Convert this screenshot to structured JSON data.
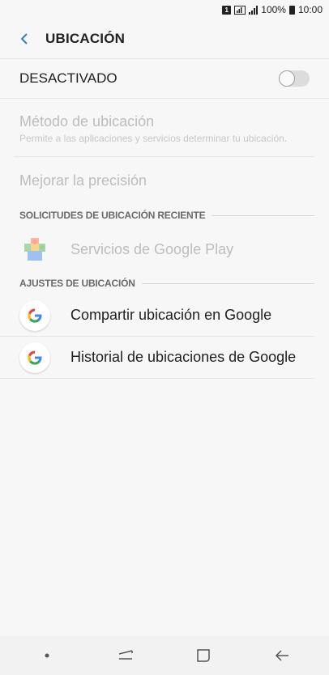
{
  "status_bar": {
    "sim_label": "1",
    "battery": "100%",
    "time": "10:00"
  },
  "app_bar": {
    "title": "UBICACIÓN",
    "back_icon": "back-chevron-icon"
  },
  "master": {
    "label": "DESACTIVADO",
    "toggle_on": false
  },
  "location_method": {
    "title": "Método de ubicación",
    "subtitle": "Permite a las aplicaciones y servicios determinar tu ubicación."
  },
  "improve_precision": {
    "title": "Mejorar la precisión"
  },
  "recent_requests": {
    "header": "SOLICITUDES DE UBICACIÓN RECIENTE",
    "items": [
      {
        "label": "Servicios de Google Play",
        "icon": "google-play-services-icon"
      }
    ]
  },
  "location_settings": {
    "header": "AJUSTES DE UBICACIÓN",
    "items": [
      {
        "label": "Compartir ubicación en Google",
        "icon": "google-g-icon"
      },
      {
        "label": "Historial de ubicaciones de Google",
        "icon": "google-g-icon"
      }
    ]
  },
  "nav_bar": {
    "icons": [
      "dot-icon",
      "recents-icon",
      "home-icon",
      "back-arrow-icon"
    ]
  },
  "colors": {
    "accent": "#3b77d8",
    "background": "#f7f7f7",
    "disabled_text": "#bdbdbd"
  }
}
